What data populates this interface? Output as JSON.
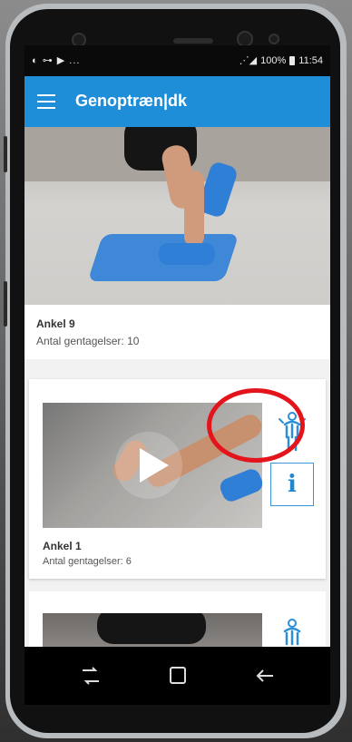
{
  "status_bar": {
    "left_icons": "◐ ⊶ ▶ ...",
    "signal": "⋰◢",
    "battery_percent": "100%",
    "time": "11:54"
  },
  "app_bar": {
    "title": "Genoptræn|dk",
    "menu_icon": "hamburger-menu-icon",
    "background": "#1e8ed8"
  },
  "exercises": [
    {
      "title": "Ankel 9",
      "reps": "Antal gentagelser: 10"
    },
    {
      "title": "Ankel 1",
      "reps": "Antal gentagelser: 6",
      "info_label": "i",
      "exercise_icon": "body-figure-icon",
      "play_icon": "play-icon"
    }
  ],
  "nav": {
    "recent": "recent-apps-icon",
    "home": "home-icon",
    "back": "back-arrow-icon"
  },
  "colors": {
    "accent": "#1e8ed8",
    "highlight": "#e3141c"
  }
}
